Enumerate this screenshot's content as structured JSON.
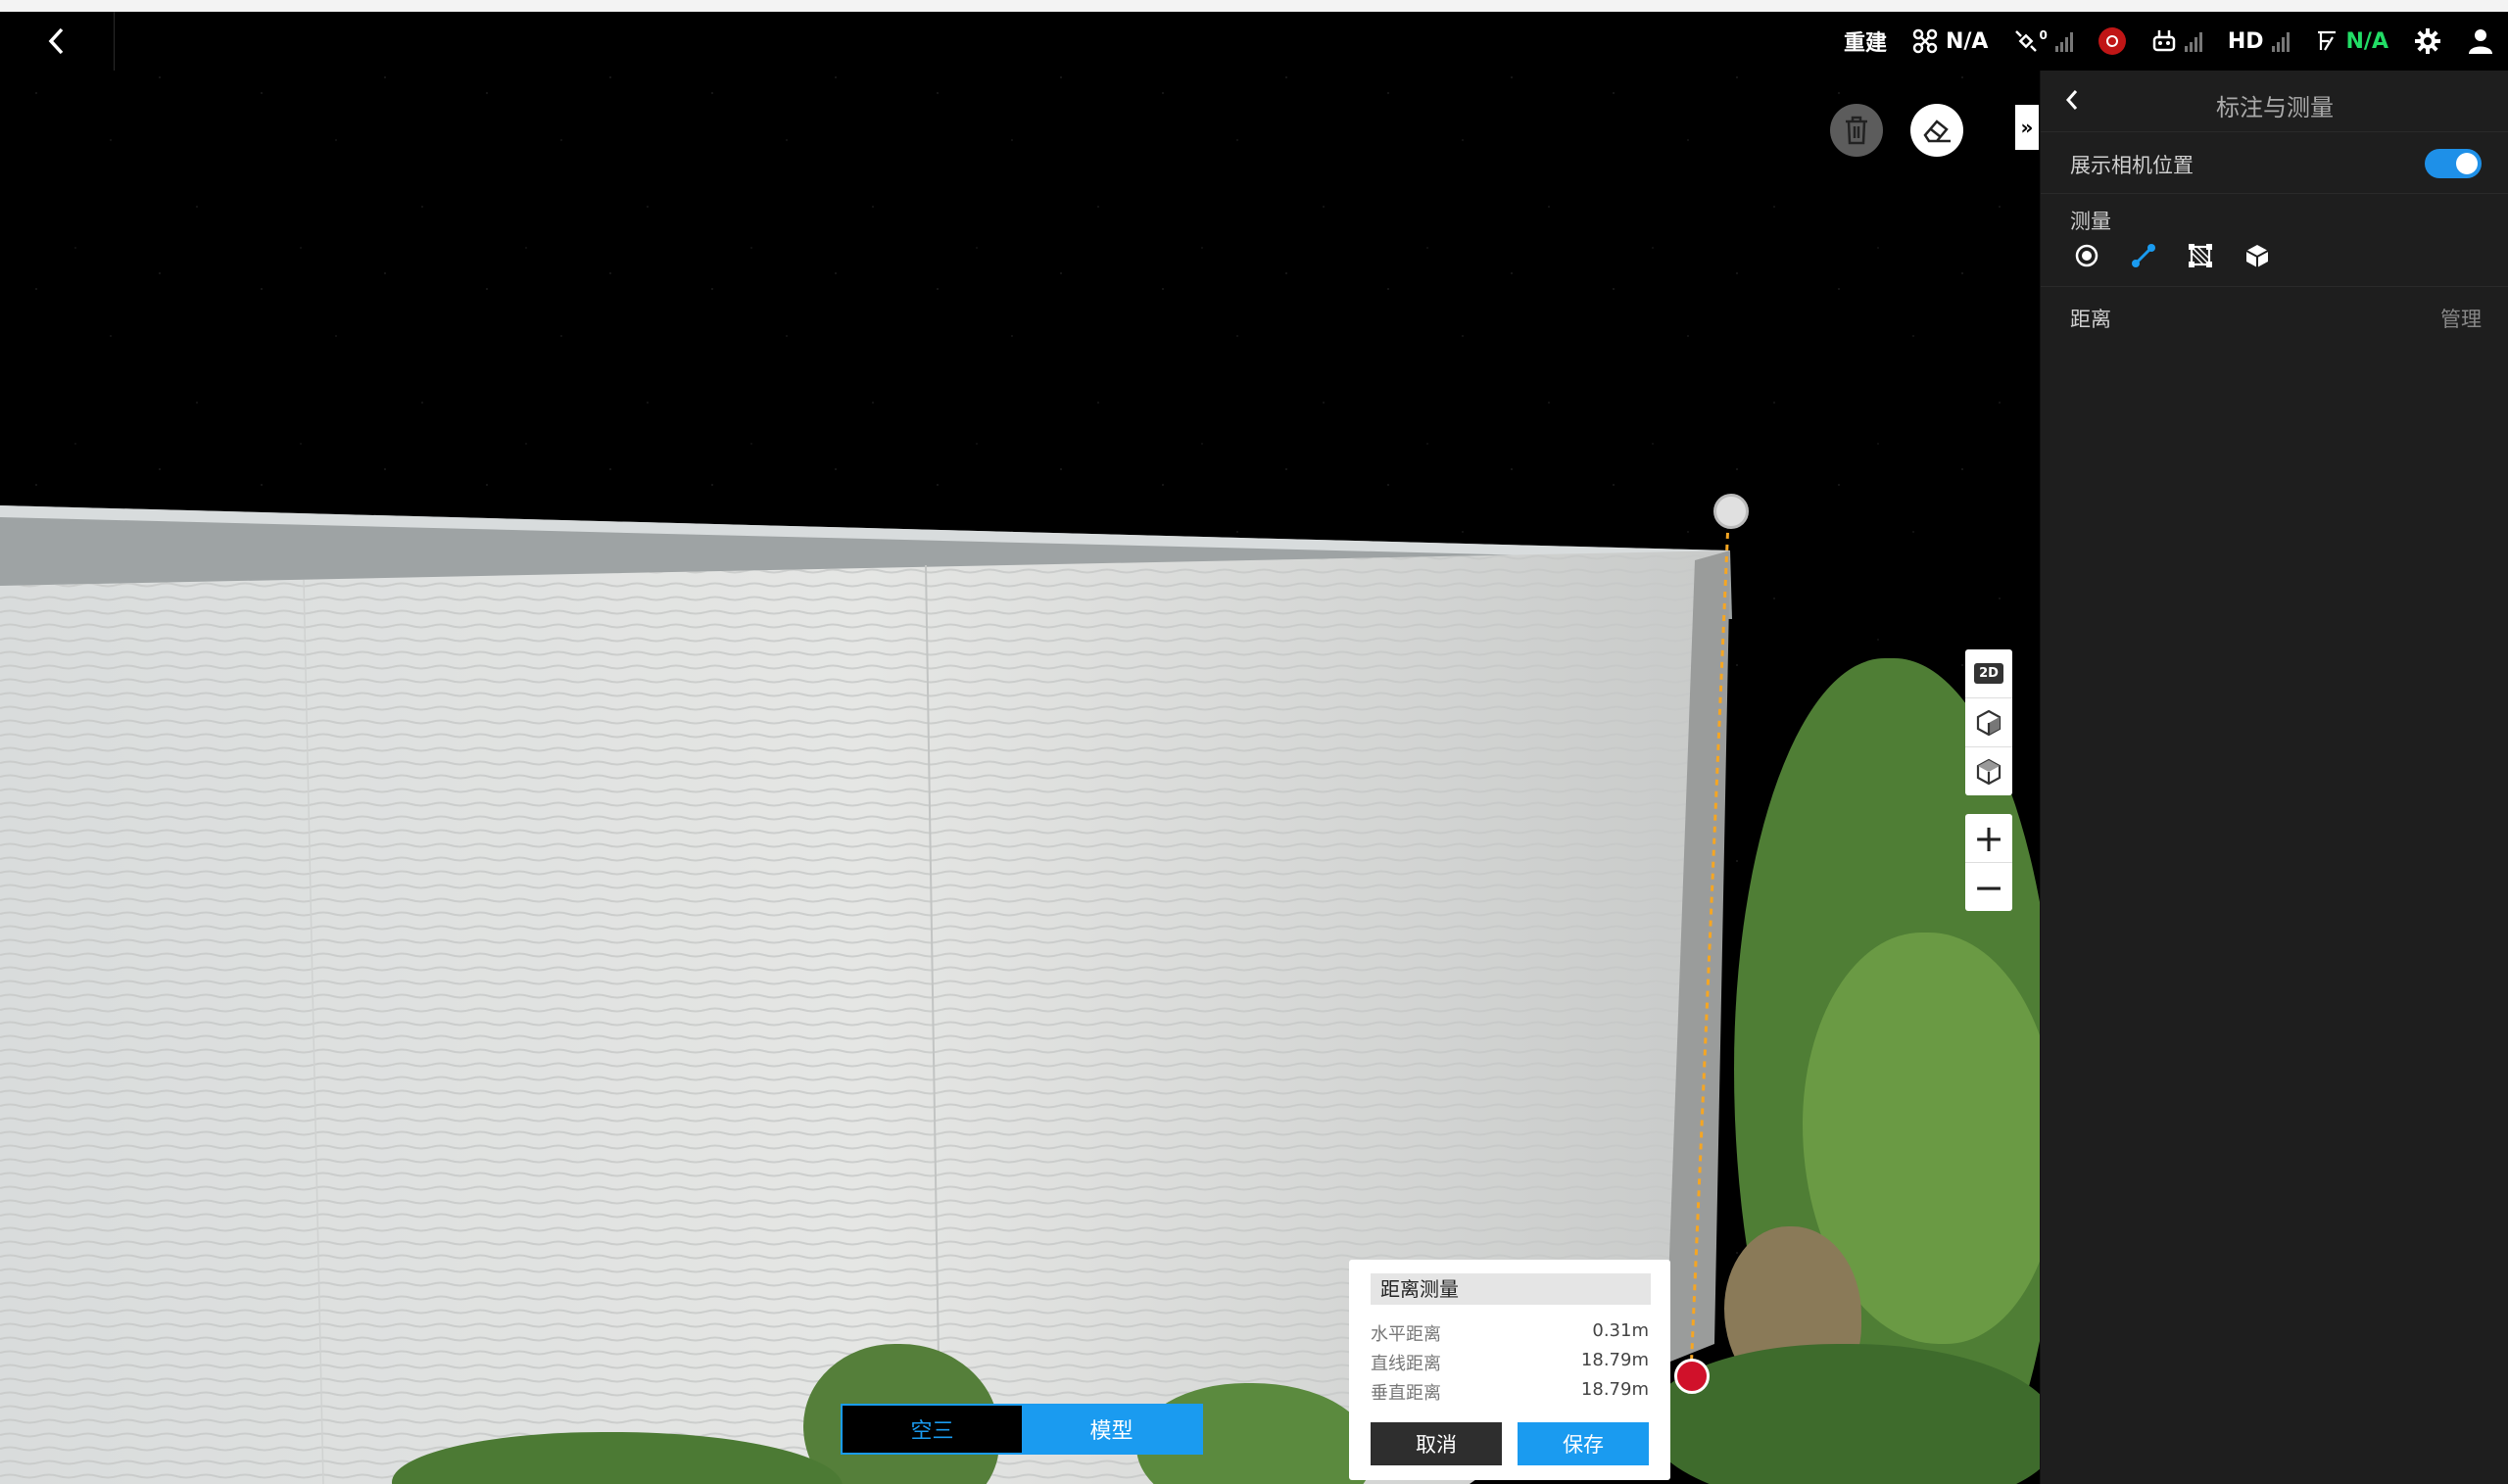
{
  "topbar": {
    "rebuild_label": "重建",
    "drone_status": "N/A",
    "gps_count": "0",
    "video_quality": "HD",
    "rtk_status": "N/A"
  },
  "panel": {
    "title": "标注与测量",
    "show_camera_label": "展示相机位置",
    "show_camera_enabled": true,
    "measure_label": "测量",
    "distance_label": "距离",
    "manage_label": "管理"
  },
  "view_tools": {
    "view_2d_label": "2D",
    "zoom_in": "+",
    "zoom_out": "−"
  },
  "mode_switch": {
    "tab_aerial": "空三",
    "tab_model": "模型",
    "active": "模型"
  },
  "measurement_popup": {
    "title": "距离测量",
    "rows": [
      {
        "label": "水平距离",
        "value": "0.31m"
      },
      {
        "label": "直线距离",
        "value": "18.79m"
      },
      {
        "label": "垂直距离",
        "value": "18.79m"
      }
    ],
    "cancel_label": "取消",
    "save_label": "保存"
  },
  "colors": {
    "accent": "#1a9bf0",
    "panel_bg": "#1e1e1e",
    "status_green": "#22dd66",
    "alert_red": "#c01616",
    "measure_line": "#f5a623"
  }
}
